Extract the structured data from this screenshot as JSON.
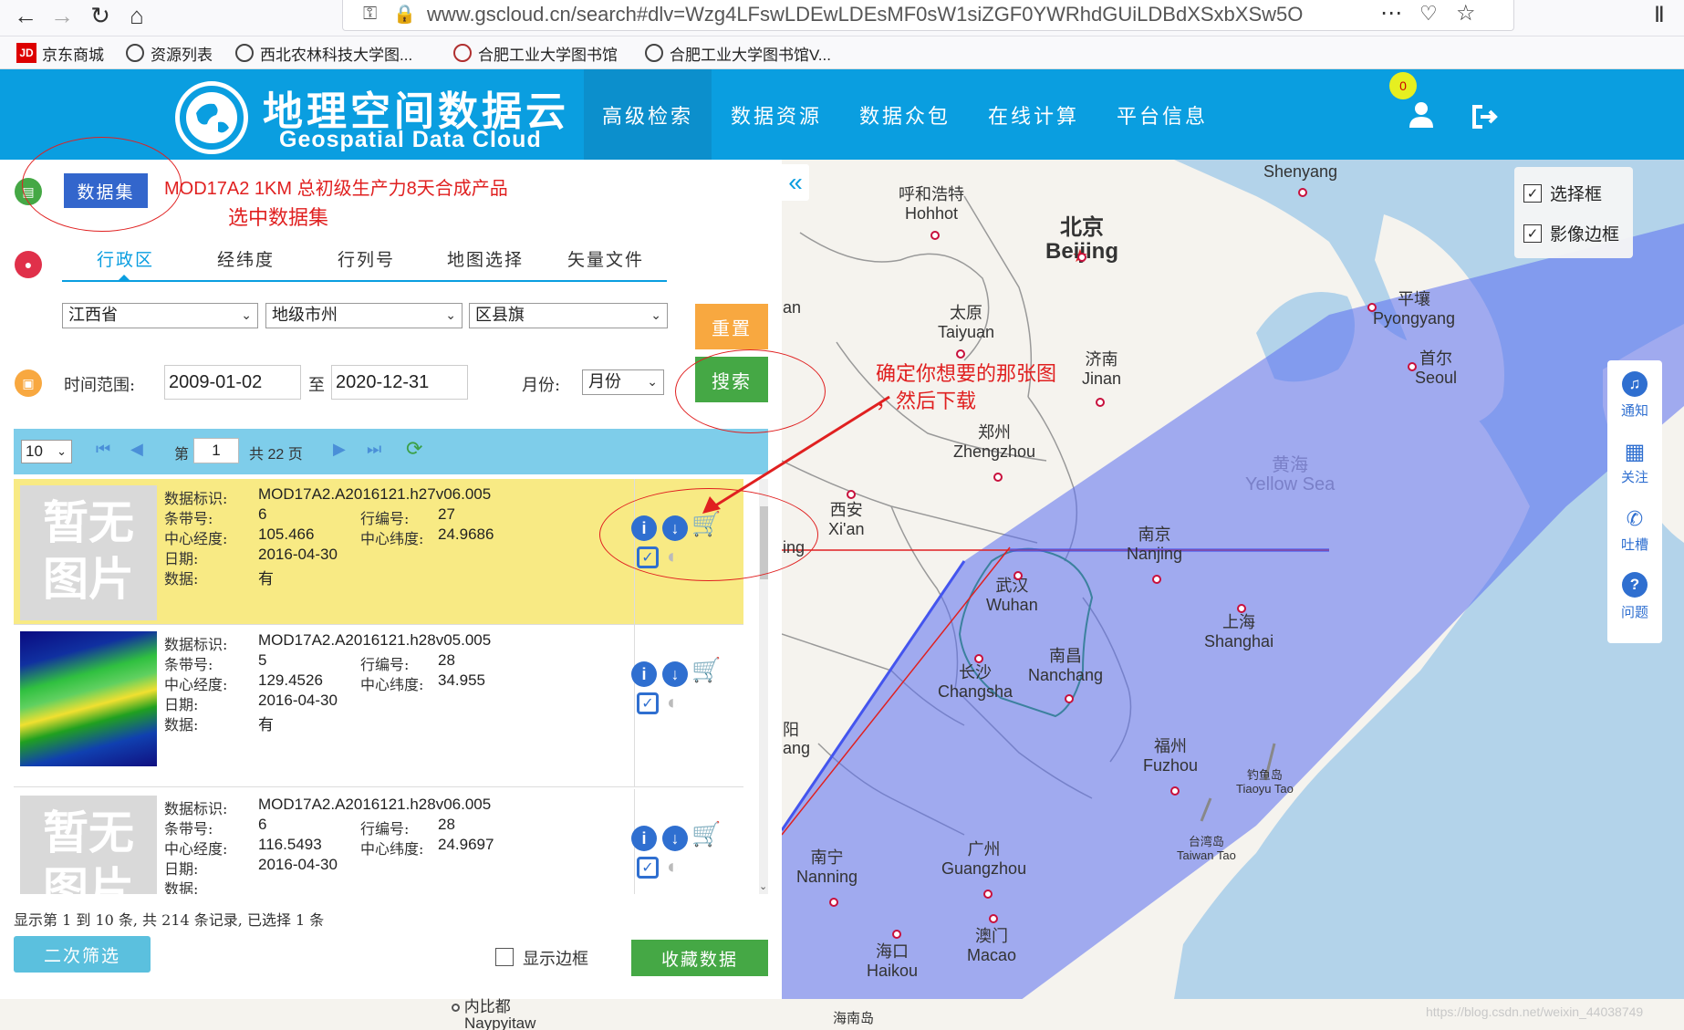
{
  "browser": {
    "url": "www.gscloud.cn/search#dlv=Wzg4LFswLDEwLDEsMF0sW1siZGF0YWRhdGUiLDBdXSxbXSw5OV0%3D",
    "bookmarks": [
      {
        "label": "京东商城",
        "icon": "jd-icon"
      },
      {
        "label": "资源列表",
        "icon": "globe-icon"
      },
      {
        "label": "西北农林科技大学图...",
        "icon": "globe-icon"
      },
      {
        "label": "合肥工业大学图书馆",
        "icon": "library-icon"
      },
      {
        "label": "合肥工业大学图书馆V...",
        "icon": "globe-icon"
      }
    ]
  },
  "header": {
    "logo_title": "地理空间数据云",
    "logo_subtitle": "Geospatial Data Cloud",
    "nav": [
      "高级检索",
      "数据资源",
      "数据众包",
      "在线计算",
      "平台信息"
    ],
    "notification_count": "0",
    "brand_color": "#0a9ee0"
  },
  "search": {
    "dataset_button": "数据集",
    "dataset_name": "MOD17A2 1KM 总初级生产力8天合成产品",
    "tabs": [
      "行政区",
      "经纬度",
      "行列号",
      "地图选择",
      "矢量文件"
    ],
    "province": "江西省",
    "city_placeholder": "地级市州",
    "county_placeholder": "区县旗",
    "reset_label": "重置",
    "search_label": "搜索",
    "time_label": "时间范围:",
    "date_from": "2009-01-02",
    "date_sep": "至",
    "date_to": "2020-12-31",
    "month_label": "月份:",
    "month_value": "月份"
  },
  "pager": {
    "page_size": "10",
    "page_prefix": "第",
    "page_current": "1",
    "page_total": "共 22 页"
  },
  "results": [
    {
      "id": "MOD17A2.A2016121.h27v06.005",
      "path": "6",
      "row": "27",
      "lon": "105.466",
      "lat": "24.9686",
      "date": "2016-04-30",
      "data": "有",
      "thumb": "暂无图片"
    },
    {
      "id": "MOD17A2.A2016121.h28v05.005",
      "path": "5",
      "row": "28",
      "lon": "129.4526",
      "lat": "34.955",
      "date": "2016-04-30",
      "data": "有",
      "thumb": ""
    },
    {
      "id": "MOD17A2.A2016121.h28v06.005",
      "path": "6",
      "row": "28",
      "lon": "116.5493",
      "lat": "24.9697",
      "date": "2016-04-30",
      "data": "",
      "thumb": "暂无图片"
    }
  ],
  "field_labels": {
    "id": "数据标识:",
    "path": "条带号:",
    "row": "行编号:",
    "lon": "中心经度:",
    "lat": "中心纬度:",
    "date": "日期:",
    "data": "数据:"
  },
  "footer": {
    "summary": "显示第 1 到 10 条, 共 214 条记录, 已选择 1 条",
    "refilter_label": "二次筛选",
    "show_border_label": "显示边框",
    "collect_label": "收藏数据"
  },
  "annotations": {
    "select_dataset": "选中数据集",
    "confirm_line1": "确定你想要的那张图",
    "confirm_line2": "，然后下载"
  },
  "map": {
    "options": [
      "选择框",
      "影像边框"
    ],
    "side_tools": [
      "通知",
      "关注",
      "吐槽",
      "问题"
    ],
    "cities": [
      {
        "cn": "Shenyang",
        "en": ""
      },
      {
        "cn": "呼和浩特",
        "en": "Hohhot"
      },
      {
        "cn": "北京",
        "en": "Beijing"
      },
      {
        "cn": "平壤",
        "en": "Pyongyang"
      },
      {
        "cn": "太原",
        "en": "Taiyuan"
      },
      {
        "cn": "首尔",
        "en": "Seoul"
      },
      {
        "cn": "济南",
        "en": "Jinan"
      },
      {
        "cn": "郑州",
        "en": "Zhengzhou"
      },
      {
        "cn": "黄海",
        "en": "Yellow Sea"
      },
      {
        "cn": "西安",
        "en": "Xi'an"
      },
      {
        "cn": "南京",
        "en": "Nanjing"
      },
      {
        "cn": "武汉",
        "en": "Wuhan"
      },
      {
        "cn": "上海",
        "en": "Shanghai"
      },
      {
        "cn": "南昌",
        "en": "Nanchang"
      },
      {
        "cn": "长沙",
        "en": "Changsha"
      },
      {
        "cn": "福州",
        "en": "Fuzhou"
      },
      {
        "cn": "钓鱼岛",
        "en": "Tiaoyu Tao"
      },
      {
        "cn": "台湾岛",
        "en": "Taiwan Tao"
      },
      {
        "cn": "广州",
        "en": "Guangzhou"
      },
      {
        "cn": "南宁",
        "en": "Nanning"
      },
      {
        "cn": "澳门",
        "en": "Macao"
      },
      {
        "cn": "海口",
        "en": "Haikou"
      },
      {
        "cn": "内比都",
        "en": "Naypyitaw"
      },
      {
        "cn": "海南岛",
        "en": ""
      }
    ],
    "edge_labels": [
      "an",
      "ing",
      "阳",
      "ang"
    ]
  },
  "watermark": "https://blog.csdn.net/weixin_44038749"
}
